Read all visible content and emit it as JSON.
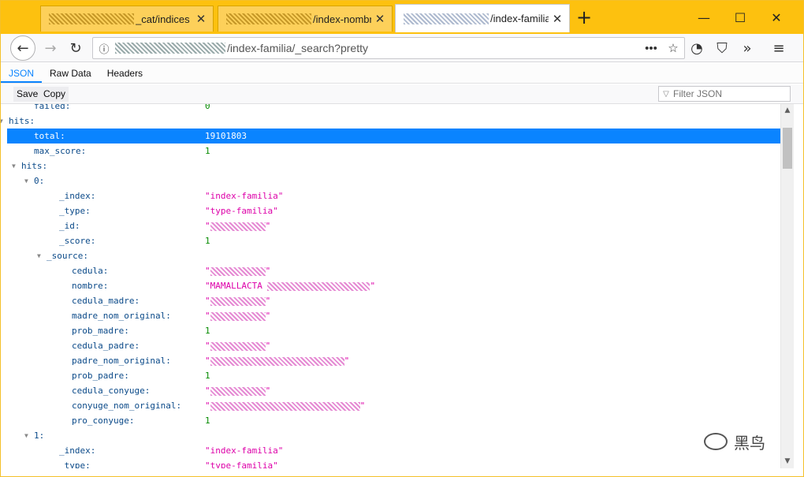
{
  "browser": {
    "tabs": [
      {
        "title": "_cat/indices",
        "active": false
      },
      {
        "title": "/index-nombre",
        "active": false
      },
      {
        "title": "/index-familia/_",
        "active": true
      }
    ],
    "new_tab_icon": "plus-icon",
    "window_controls": [
      "minimize-icon",
      "maximize-icon",
      "close-icon"
    ],
    "url": "/index-familia/_search?pretty",
    "url_icons": [
      "more-icon",
      "star-icon",
      "pocket-icon",
      "shield-icon",
      "overflow-icon",
      "menu-icon"
    ]
  },
  "viewer": {
    "tabs": [
      "JSON",
      "Raw Data",
      "Headers"
    ],
    "selected_tab": "JSON",
    "save_label": "Save",
    "copy_label": "Copy",
    "filter_placeholder": "Filter JSON"
  },
  "tree": [
    {
      "key": "failed:",
      "value": "0",
      "type": "num",
      "depth": 2,
      "twisty": false
    },
    {
      "key": "hits:",
      "value": "",
      "type": "obj",
      "depth": 0,
      "twisty": true
    },
    {
      "key": "total:",
      "value": "19101803",
      "type": "num",
      "depth": 2,
      "twisty": false,
      "selected": true
    },
    {
      "key": "max_score:",
      "value": "1",
      "type": "num",
      "depth": 2,
      "twisty": false
    },
    {
      "key": "hits:",
      "value": "",
      "type": "obj",
      "depth": 1,
      "twisty": true
    },
    {
      "key": "0:",
      "value": "",
      "type": "obj",
      "depth": 2,
      "twisty": true
    },
    {
      "key": "_index:",
      "value": "\"index-familia\"",
      "type": "str",
      "depth": 4,
      "twisty": false
    },
    {
      "key": "_type:",
      "value": "\"type-familia\"",
      "type": "str",
      "depth": 4,
      "twisty": false
    },
    {
      "key": "_id:",
      "value": "\"\"",
      "type": "str",
      "depth": 4,
      "twisty": false,
      "redacted": 70
    },
    {
      "key": "_score:",
      "value": "1",
      "type": "num",
      "depth": 4,
      "twisty": false
    },
    {
      "key": "_source:",
      "value": "",
      "type": "obj",
      "depth": 3,
      "twisty": true
    },
    {
      "key": "cedula:",
      "value": "\"\"",
      "type": "str",
      "depth": 5,
      "twisty": false,
      "redacted": 70
    },
    {
      "key": "nombre:",
      "value": "\"MAMALLACTA",
      "type": "str",
      "depth": 5,
      "twisty": false,
      "redacted": 130
    },
    {
      "key": "cedula_madre:",
      "value": "\"\"",
      "type": "str",
      "depth": 5,
      "twisty": false,
      "redacted": 70
    },
    {
      "key": "madre_nom_original:",
      "value": "\"\"",
      "type": "str",
      "depth": 5,
      "twisty": false,
      "redacted": 70
    },
    {
      "key": "prob_madre:",
      "value": "1",
      "type": "num",
      "depth": 5,
      "twisty": false
    },
    {
      "key": "cedula_padre:",
      "value": "\"\"",
      "type": "str",
      "depth": 5,
      "twisty": false,
      "redacted": 70
    },
    {
      "key": "padre_nom_original:",
      "value": "\"\"",
      "type": "str",
      "depth": 5,
      "twisty": false,
      "redacted": 170
    },
    {
      "key": "prob_padre:",
      "value": "1",
      "type": "num",
      "depth": 5,
      "twisty": false
    },
    {
      "key": "cedula_conyuge:",
      "value": "\"\"",
      "type": "str",
      "depth": 5,
      "twisty": false,
      "redacted": 70
    },
    {
      "key": "conyuge_nom_original:",
      "value": "\"\"",
      "type": "str",
      "depth": 5,
      "twisty": false,
      "redacted": 190
    },
    {
      "key": "pro_conyuge:",
      "value": "1",
      "type": "num",
      "depth": 5,
      "twisty": false
    },
    {
      "key": "1:",
      "value": "",
      "type": "obj",
      "depth": 2,
      "twisty": true
    },
    {
      "key": "_index:",
      "value": "\"index-familia\"",
      "type": "str",
      "depth": 4,
      "twisty": false
    },
    {
      "key": "_type:",
      "value": "\"type-familia\"",
      "type": "str",
      "depth": 4,
      "twisty": false
    }
  ],
  "watermark": {
    "text": "黑鸟",
    "icon": "wechat-icon"
  }
}
